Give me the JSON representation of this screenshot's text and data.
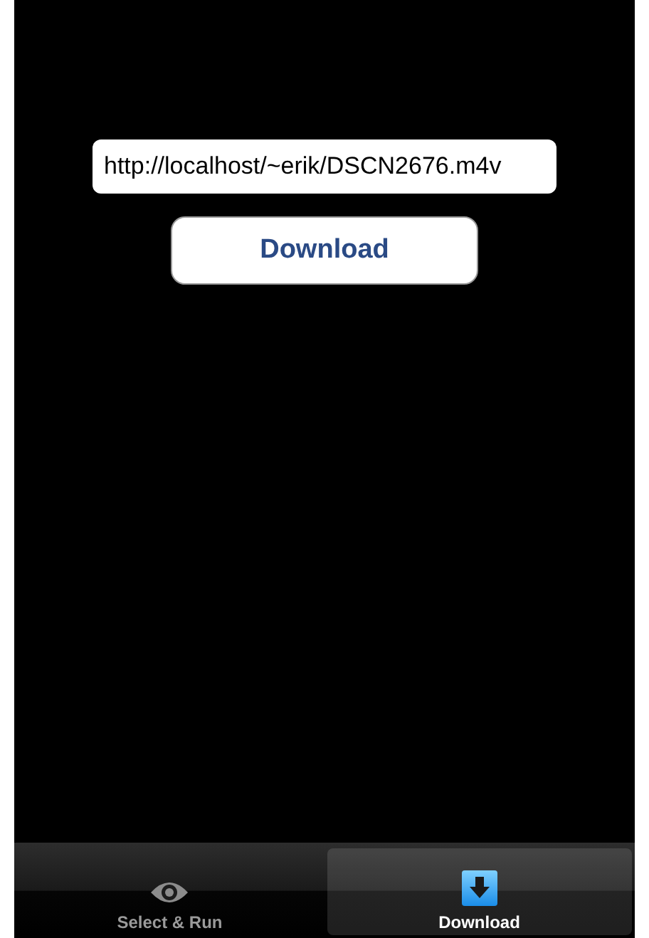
{
  "url_field": {
    "value": "http://localhost/~erik/DSCN2676.m4v"
  },
  "download_button": {
    "label": "Download"
  },
  "tabs": [
    {
      "label": "Select & Run",
      "selected": false
    },
    {
      "label": "Download",
      "selected": true
    }
  ]
}
